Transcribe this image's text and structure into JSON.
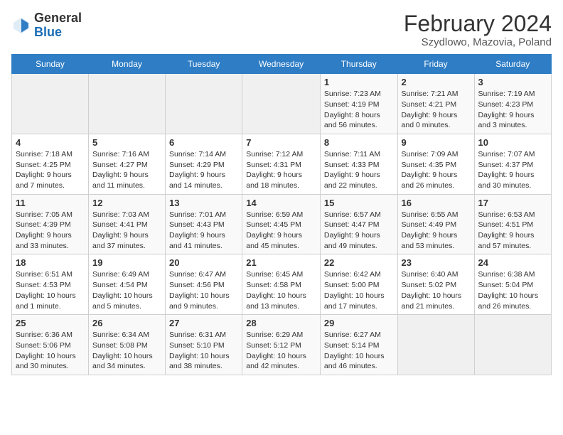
{
  "header": {
    "logo_general": "General",
    "logo_blue": "Blue",
    "month_year": "February 2024",
    "location": "Szydlowo, Mazovia, Poland"
  },
  "days_of_week": [
    "Sunday",
    "Monday",
    "Tuesday",
    "Wednesday",
    "Thursday",
    "Friday",
    "Saturday"
  ],
  "weeks": [
    [
      {
        "num": "",
        "info": ""
      },
      {
        "num": "",
        "info": ""
      },
      {
        "num": "",
        "info": ""
      },
      {
        "num": "",
        "info": ""
      },
      {
        "num": "1",
        "info": "Sunrise: 7:23 AM\nSunset: 4:19 PM\nDaylight: 8 hours\nand 56 minutes."
      },
      {
        "num": "2",
        "info": "Sunrise: 7:21 AM\nSunset: 4:21 PM\nDaylight: 9 hours\nand 0 minutes."
      },
      {
        "num": "3",
        "info": "Sunrise: 7:19 AM\nSunset: 4:23 PM\nDaylight: 9 hours\nand 3 minutes."
      }
    ],
    [
      {
        "num": "4",
        "info": "Sunrise: 7:18 AM\nSunset: 4:25 PM\nDaylight: 9 hours\nand 7 minutes."
      },
      {
        "num": "5",
        "info": "Sunrise: 7:16 AM\nSunset: 4:27 PM\nDaylight: 9 hours\nand 11 minutes."
      },
      {
        "num": "6",
        "info": "Sunrise: 7:14 AM\nSunset: 4:29 PM\nDaylight: 9 hours\nand 14 minutes."
      },
      {
        "num": "7",
        "info": "Sunrise: 7:12 AM\nSunset: 4:31 PM\nDaylight: 9 hours\nand 18 minutes."
      },
      {
        "num": "8",
        "info": "Sunrise: 7:11 AM\nSunset: 4:33 PM\nDaylight: 9 hours\nand 22 minutes."
      },
      {
        "num": "9",
        "info": "Sunrise: 7:09 AM\nSunset: 4:35 PM\nDaylight: 9 hours\nand 26 minutes."
      },
      {
        "num": "10",
        "info": "Sunrise: 7:07 AM\nSunset: 4:37 PM\nDaylight: 9 hours\nand 30 minutes."
      }
    ],
    [
      {
        "num": "11",
        "info": "Sunrise: 7:05 AM\nSunset: 4:39 PM\nDaylight: 9 hours\nand 33 minutes."
      },
      {
        "num": "12",
        "info": "Sunrise: 7:03 AM\nSunset: 4:41 PM\nDaylight: 9 hours\nand 37 minutes."
      },
      {
        "num": "13",
        "info": "Sunrise: 7:01 AM\nSunset: 4:43 PM\nDaylight: 9 hours\nand 41 minutes."
      },
      {
        "num": "14",
        "info": "Sunrise: 6:59 AM\nSunset: 4:45 PM\nDaylight: 9 hours\nand 45 minutes."
      },
      {
        "num": "15",
        "info": "Sunrise: 6:57 AM\nSunset: 4:47 PM\nDaylight: 9 hours\nand 49 minutes."
      },
      {
        "num": "16",
        "info": "Sunrise: 6:55 AM\nSunset: 4:49 PM\nDaylight: 9 hours\nand 53 minutes."
      },
      {
        "num": "17",
        "info": "Sunrise: 6:53 AM\nSunset: 4:51 PM\nDaylight: 9 hours\nand 57 minutes."
      }
    ],
    [
      {
        "num": "18",
        "info": "Sunrise: 6:51 AM\nSunset: 4:53 PM\nDaylight: 10 hours\nand 1 minute."
      },
      {
        "num": "19",
        "info": "Sunrise: 6:49 AM\nSunset: 4:54 PM\nDaylight: 10 hours\nand 5 minutes."
      },
      {
        "num": "20",
        "info": "Sunrise: 6:47 AM\nSunset: 4:56 PM\nDaylight: 10 hours\nand 9 minutes."
      },
      {
        "num": "21",
        "info": "Sunrise: 6:45 AM\nSunset: 4:58 PM\nDaylight: 10 hours\nand 13 minutes."
      },
      {
        "num": "22",
        "info": "Sunrise: 6:42 AM\nSunset: 5:00 PM\nDaylight: 10 hours\nand 17 minutes."
      },
      {
        "num": "23",
        "info": "Sunrise: 6:40 AM\nSunset: 5:02 PM\nDaylight: 10 hours\nand 21 minutes."
      },
      {
        "num": "24",
        "info": "Sunrise: 6:38 AM\nSunset: 5:04 PM\nDaylight: 10 hours\nand 26 minutes."
      }
    ],
    [
      {
        "num": "25",
        "info": "Sunrise: 6:36 AM\nSunset: 5:06 PM\nDaylight: 10 hours\nand 30 minutes."
      },
      {
        "num": "26",
        "info": "Sunrise: 6:34 AM\nSunset: 5:08 PM\nDaylight: 10 hours\nand 34 minutes."
      },
      {
        "num": "27",
        "info": "Sunrise: 6:31 AM\nSunset: 5:10 PM\nDaylight: 10 hours\nand 38 minutes."
      },
      {
        "num": "28",
        "info": "Sunrise: 6:29 AM\nSunset: 5:12 PM\nDaylight: 10 hours\nand 42 minutes."
      },
      {
        "num": "29",
        "info": "Sunrise: 6:27 AM\nSunset: 5:14 PM\nDaylight: 10 hours\nand 46 minutes."
      },
      {
        "num": "",
        "info": ""
      },
      {
        "num": "",
        "info": ""
      }
    ]
  ]
}
